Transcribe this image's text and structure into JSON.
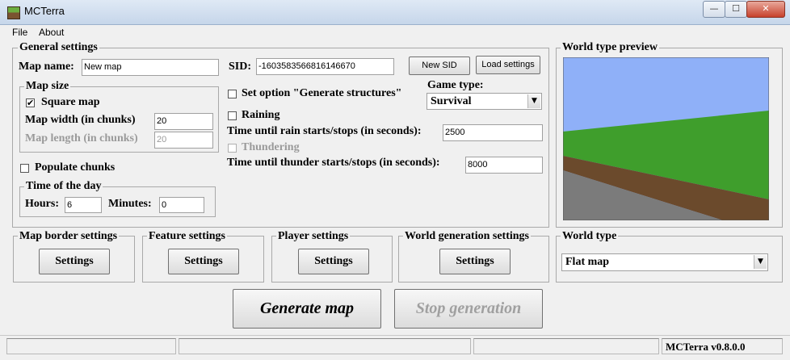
{
  "window": {
    "title": "MCTerra",
    "minimize_glyph": "—",
    "maximize_glyph": "☐",
    "close_glyph": "✕"
  },
  "menu": {
    "file": "File",
    "about": "About"
  },
  "general": {
    "legend": "General settings",
    "map_name_label": "Map name:",
    "map_name_value": "New map",
    "sid_label": "SID:",
    "sid_value": "-1603583566816146670",
    "new_sid_button": "New SID",
    "load_settings_button": "Load settings",
    "map_size": {
      "legend": "Map size",
      "square_map_label": "Square map",
      "square_map_checked": true,
      "map_width_label": "Map width (in chunks)",
      "map_width_value": "20",
      "map_length_label": "Map length (in chunks)",
      "map_length_value": "20"
    },
    "populate_chunks_label": "Populate chunks",
    "time_of_day": {
      "legend": "Time of the day",
      "hours_label": "Hours:",
      "hours_value": "6",
      "minutes_label": "Minutes:",
      "minutes_value": "0"
    },
    "generate_structures_label": "Set option \"Generate structures\"",
    "game_type_label": "Game type:",
    "game_type_value": "Survival",
    "raining_label": "Raining",
    "rain_time_label": "Time until rain starts/stops (in seconds):",
    "rain_time_value": "2500",
    "thundering_label": "Thundering",
    "thunder_time_label": "Time until thunder starts/stops (in seconds):",
    "thunder_time_value": "8000"
  },
  "preview": {
    "legend": "World type preview",
    "sky_color": "#8fb0f8",
    "grass_color": "#3f9e2c",
    "dirt_color": "#6b4a2c",
    "stone_color": "#7b7b7b"
  },
  "sections": [
    {
      "legend": "Map border settings",
      "button": "Settings"
    },
    {
      "legend": "Feature settings",
      "button": "Settings"
    },
    {
      "legend": "Player settings",
      "button": "Settings"
    },
    {
      "legend": "World generation settings",
      "button": "Settings"
    }
  ],
  "world_type": {
    "legend": "World type",
    "value": "Flat map"
  },
  "actions": {
    "generate": "Generate map",
    "stop": "Stop generation"
  },
  "status": {
    "version": "MCTerra v0.8.0.0"
  },
  "icons": {
    "check": "✔",
    "dropdown": "▼"
  }
}
